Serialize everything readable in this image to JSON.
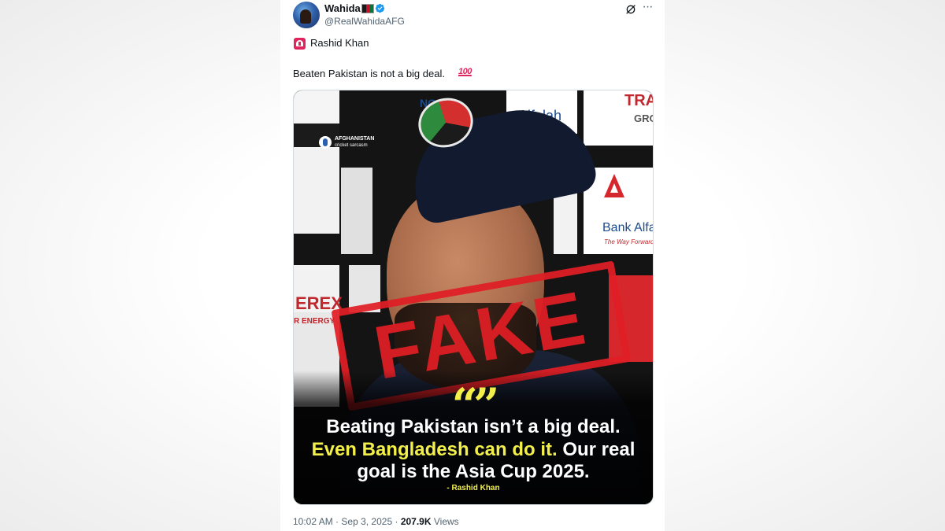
{
  "author": {
    "display_name": "Wahida",
    "handle": "@RealWahidaAFG",
    "flag_colors": [
      "#1a1a1a",
      "#c8102e",
      "#007a36"
    ],
    "verified": true
  },
  "icons": {
    "avatar": "avatar",
    "verified": "verified-badge-icon",
    "grok": "grok-icon",
    "more": "more-icon",
    "siren": "siren-emoji-icon",
    "hundred": "hundred-points-emoji-icon"
  },
  "tweet": {
    "line1": "Rashid Khan",
    "line2": "Beaten Pakistan is not a big deal.",
    "hundred_glyph": "100"
  },
  "media": {
    "watermark_title": "AFGHANISTAN",
    "watermark_subtitle": "cricket sarcasm",
    "boards": {
      "bank_alfalah": "Bank Alfalah",
      "bank_alfalah_tagline": "The Way Forward",
      "alfalah_top": "Alfalah",
      "tra_top": "TRA",
      "gro": "GRO",
      "erex": "EREX",
      "r_energy": "R ENERGY",
      "no": "NO"
    },
    "stamp": "FAKE",
    "quote_mark": "“”",
    "quote_line1": "Beating Pakistan isn’t a big deal.",
    "quote_line2_highlight": "Even Bangladesh can do it.",
    "quote_line2_rest": " Our real",
    "quote_line3": "goal is the Asia Cup 2025.",
    "attribution": "- Rashid Khan"
  },
  "meta": {
    "time": "10:02 AM",
    "sep": "·",
    "date": "Sep 3, 2025",
    "views_count": "207.9K",
    "views_label": "Views"
  },
  "colors": {
    "accent_yellow": "#f2ef4b",
    "stamp_red": "#e01e25",
    "verified_blue": "#1d9bf0"
  }
}
